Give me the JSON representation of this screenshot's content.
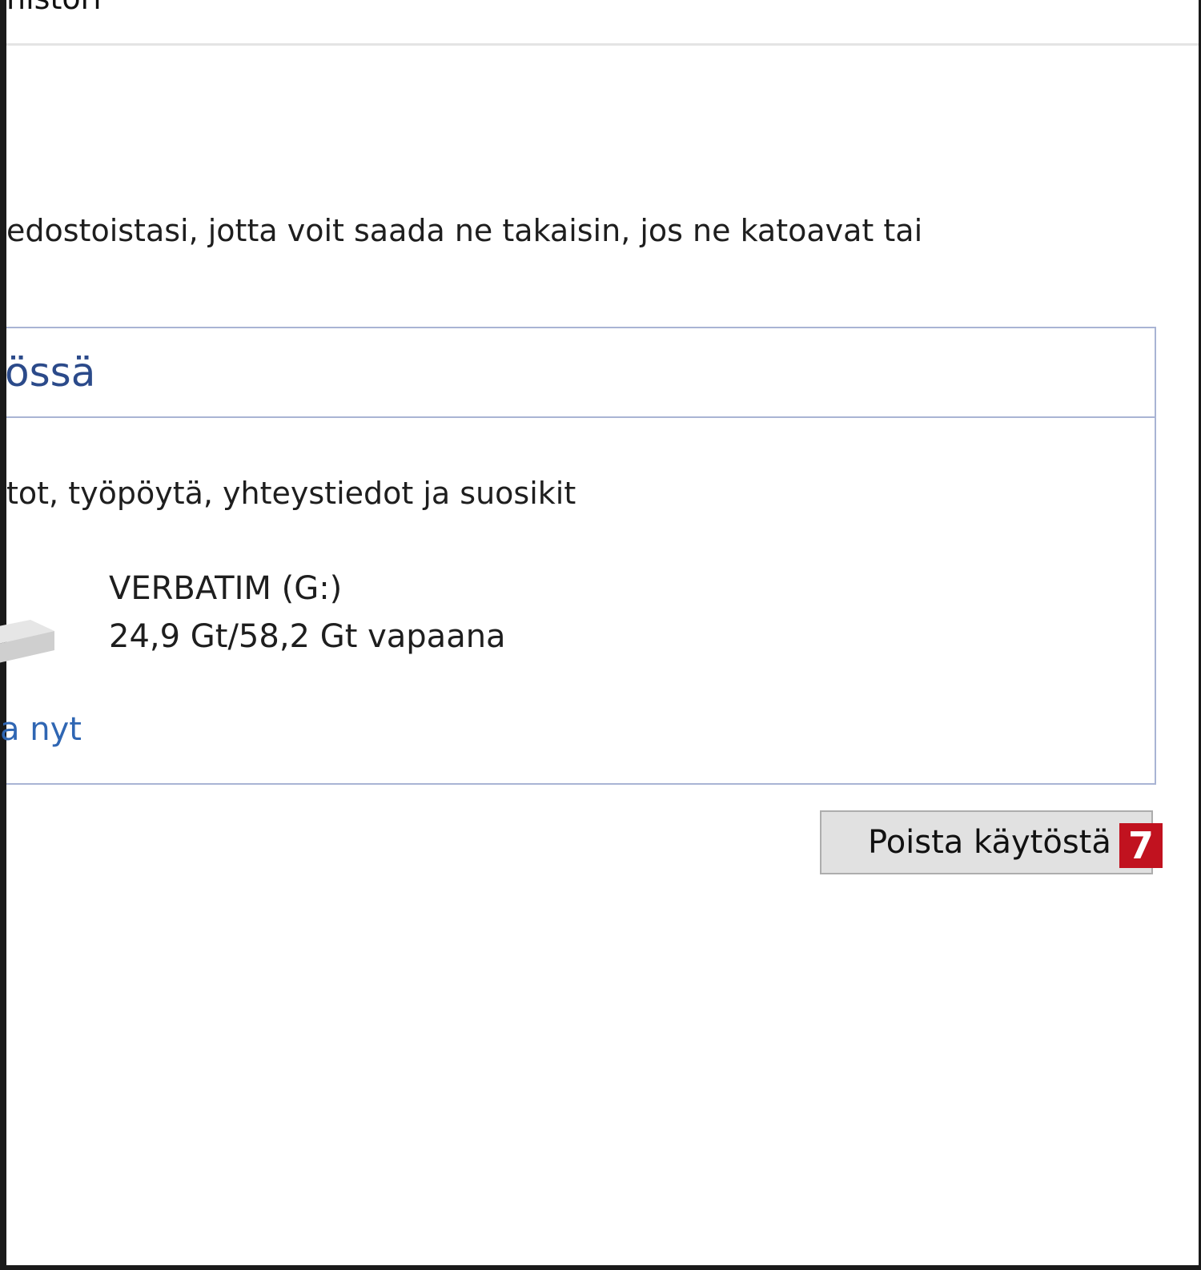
{
  "nav": {
    "breadcrumb": "histori"
  },
  "description": "edostoistasi, jotta voit saada ne takaisin, jos ne katoavat tai",
  "panel": {
    "title": "össä",
    "folders_text": "tot, työpöytä, yhteystiedot ja suosikit",
    "drive": {
      "name": "VERBATIM (G:)",
      "space": "24,9 Gt/58,2 Gt vapaana",
      "icon": "usb-drive-icon"
    },
    "run_link": "a nyt"
  },
  "actions": {
    "disable_label": "Poista käytöstä",
    "step_badge": "7"
  },
  "colors": {
    "panel_border": "#a9b4d4",
    "title": "#2b4a8a",
    "link": "#2f66b3",
    "badge": "#c1121f"
  }
}
